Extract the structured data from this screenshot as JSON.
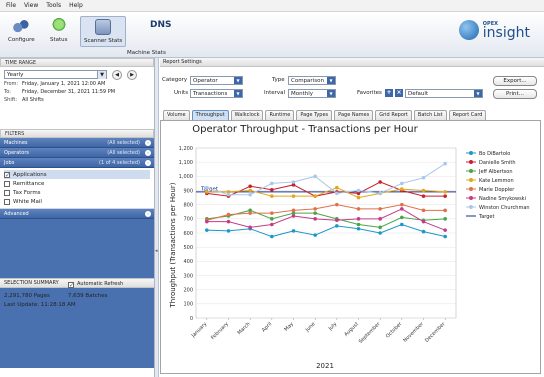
{
  "menu": [
    "File",
    "View",
    "Tools",
    "Help"
  ],
  "toolbar": {
    "buttons": [
      {
        "label": "Configure",
        "icon": "gear-cluster-icon"
      },
      {
        "label": "Status",
        "icon": "status-lightbulb-icon"
      },
      {
        "label": "Scanner Stats",
        "icon": "scanner-icon"
      },
      {
        "label": "Machine Stats",
        "icon": "machine-icon"
      }
    ],
    "dns_label": "DNS",
    "brand_small": "OPEX",
    "brand_big": "insight"
  },
  "time_range": {
    "header": "TIME RANGE",
    "period": "Yearly",
    "from_label": "From:",
    "from_value": "Friday, January 1, 2021 12:00 AM",
    "to_label": "To:",
    "to_value": "Friday, December 31, 2021 11:59 PM",
    "shift_label": "Shift:",
    "shift_value": "All Shifts"
  },
  "filters": {
    "header": "FILTERS",
    "rows": [
      {
        "name": "Machines",
        "count": "(All selected)"
      },
      {
        "name": "Operators",
        "count": "(All selected)"
      },
      {
        "name": "Jobs",
        "count": "(1 of 4 selected)"
      }
    ],
    "jobs": [
      {
        "name": "Applications",
        "checked": true
      },
      {
        "name": "Remittance",
        "checked": false
      },
      {
        "name": "Tax Forms",
        "checked": false
      },
      {
        "name": "White Mail",
        "checked": false
      }
    ],
    "advanced": "Advanced"
  },
  "summary": {
    "header": "SELECTION SUMMARY",
    "auto_refresh": "Automatic Refresh",
    "pages": "2,291,780 Pages",
    "batches": "7,639 Batches",
    "last_update": "Last Update: 11:28:18 AM"
  },
  "report_settings": {
    "header": "Report Settings",
    "category_label": "Category",
    "category_value": "Operator",
    "type_label": "Type",
    "type_value": "Comparison",
    "units_label": "Units",
    "units_value": "Transactions",
    "interval_label": "Interval",
    "interval_value": "Monthly",
    "favorites_label": "Favorites",
    "favorites_value": "Default",
    "export_label": "Export...",
    "print_label": "Print..."
  },
  "tabs": [
    "Volume",
    "Throughput",
    "Walkclock",
    "Runtime",
    "Page Types",
    "Page Names",
    "Grid Report",
    "Batch List",
    "Report Card"
  ],
  "active_tab": 1,
  "chart_data": {
    "type": "line",
    "title": "Operator Throughput - Transactions per Hour",
    "xlabel": "2021",
    "ylabel": "Throughput (Transactions per Hour)",
    "ylim": [
      0,
      1200
    ],
    "yticks": [
      0,
      100,
      200,
      300,
      400,
      500,
      600,
      700,
      800,
      900,
      1000,
      1100,
      1200
    ],
    "categories": [
      "January",
      "February",
      "March",
      "April",
      "May",
      "June",
      "July",
      "August",
      "September",
      "October",
      "November",
      "December"
    ],
    "target_label": "Target",
    "target_value": 890,
    "legend_position": "right",
    "series": [
      {
        "name": "Bo DiBartolo",
        "color": "#1f96c8",
        "values": [
          620,
          615,
          630,
          575,
          615,
          585,
          650,
          630,
          600,
          660,
          610,
          575
        ]
      },
      {
        "name": "Danielle Smith",
        "color": "#c8202d",
        "values": [
          880,
          860,
          930,
          905,
          940,
          860,
          890,
          880,
          960,
          900,
          860,
          860
        ]
      },
      {
        "name": "Jeff Albertson",
        "color": "#4aa54a",
        "values": [
          700,
          720,
          760,
          700,
          740,
          740,
          700,
          660,
          640,
          710,
          690,
          700
        ]
      },
      {
        "name": "Kate Lemmon",
        "color": "#e0a81e",
        "values": [
          890,
          890,
          900,
          860,
          860,
          860,
          920,
          850,
          880,
          910,
          900,
          890
        ]
      },
      {
        "name": "Marie Doppler",
        "color": "#e0704a",
        "values": [
          690,
          730,
          740,
          740,
          760,
          770,
          800,
          770,
          770,
          800,
          760,
          760
        ]
      },
      {
        "name": "Nadine Smykowski",
        "color": "#c73a8a",
        "values": [
          680,
          680,
          640,
          660,
          720,
          700,
          690,
          700,
          700,
          770,
          680,
          620
        ]
      },
      {
        "name": "Winston Churchman",
        "color": "#a8c8ea",
        "values": [
          920,
          870,
          870,
          950,
          960,
          1000,
          880,
          900,
          880,
          950,
          990,
          1090
        ]
      }
    ]
  }
}
